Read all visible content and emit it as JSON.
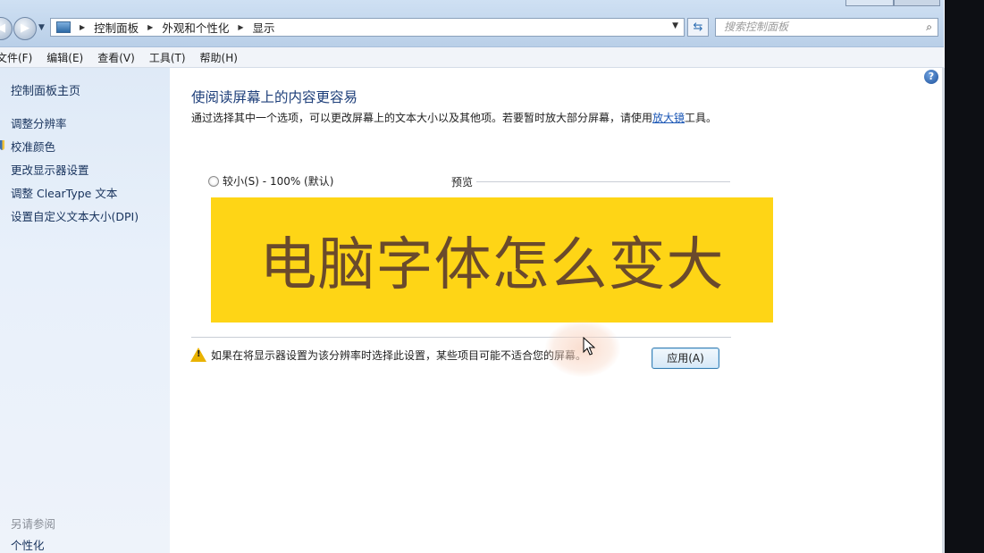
{
  "address_bar": {
    "crumbs": [
      "控制面板",
      "外观和个性化",
      "显示"
    ]
  },
  "search": {
    "placeholder": "搜索控制面板"
  },
  "menu": [
    "文件(F)",
    "编辑(E)",
    "查看(V)",
    "工具(T)",
    "帮助(H)"
  ],
  "sidebar": {
    "home": "控制面板主页",
    "items": [
      "调整分辨率",
      "校准颜色",
      "更改显示器设置",
      "调整 ClearType 文本",
      "设置自定义文本大小(DPI)"
    ],
    "see_also_title": "另请参阅",
    "see_also_items": [
      "个性化"
    ]
  },
  "main": {
    "title": "使阅读屏幕上的内容更容易",
    "description_before_link": "通过选择其中一个选项，可以更改屏幕上的文本大小以及其他项。若要暂时放大部分屏幕，请使用",
    "description_link": "放大镜",
    "description_after_link": "工具。",
    "option_small": "较小(S) - 100% (默认)",
    "preview_label": "预览",
    "banner_text": "电脑字体怎么变大",
    "warning_text": "如果在将显示器设置为该分辨率时选择此设置，某些项目可能不适合您的屏幕。",
    "apply_button": "应用(A)"
  },
  "colors": {
    "banner_bg": "#fed516",
    "banner_text": "#6a4a2c",
    "title": "#1e3f7a",
    "link": "#1a56b5"
  }
}
